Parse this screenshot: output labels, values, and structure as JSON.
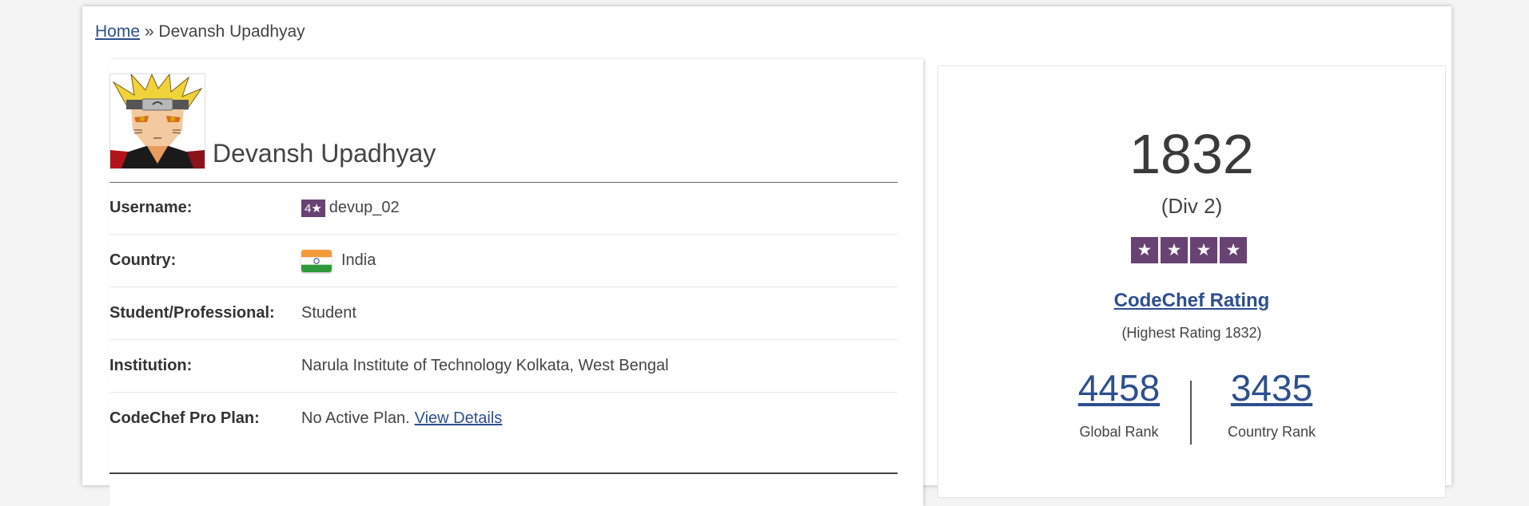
{
  "breadcrumb": {
    "home": "Home",
    "separator": "»",
    "current": "Devansh Upadhyay"
  },
  "profile": {
    "name": "Devansh Upadhyay",
    "avatar_icon": "naruto-avatar",
    "details": {
      "username_label": "Username:",
      "username_badge": "4★",
      "username": "devup_02",
      "country_label": "Country:",
      "country": "India",
      "country_flag_icon": "india-flag-icon",
      "student_label": "Student/Professional:",
      "student": "Student",
      "institution_label": "Institution:",
      "institution": "Narula Institute of Technology Kolkata, West Bengal",
      "plan_label": "CodeChef Pro Plan:",
      "plan": "No Active Plan.",
      "plan_link": "View Details"
    }
  },
  "rating_panel": {
    "rating": "1832",
    "division": "(Div 2)",
    "stars": 4,
    "star_glyph": "★",
    "rating_title": "CodeChef Rating",
    "highest": "(Highest Rating 1832)",
    "global_rank": "4458",
    "global_rank_label": "Global Rank",
    "country_rank": "3435",
    "country_rank_label": "Country Rank"
  },
  "colors": {
    "accent": "#684273",
    "link": "#2e4f8f"
  }
}
